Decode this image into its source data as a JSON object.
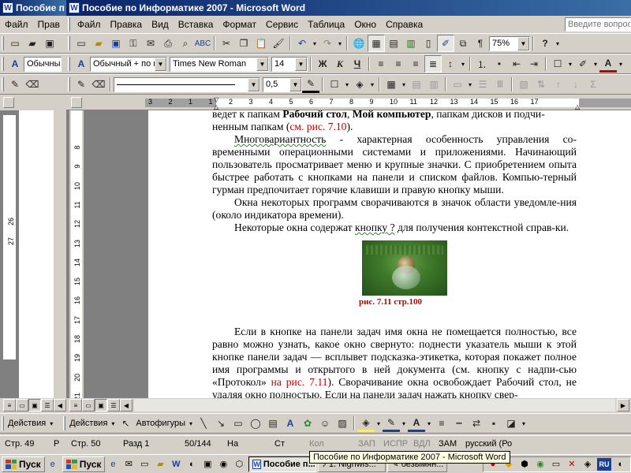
{
  "window": {
    "left_title": "Пособие п",
    "main_title": "Пособие по Информатике 2007  - Microsoft Word",
    "word_icon": "W"
  },
  "menu": {
    "left_items": [
      "Файл",
      "Прав"
    ],
    "items": [
      "Файл",
      "Правка",
      "Вид",
      "Вставка",
      "Формат",
      "Сервис",
      "Таблица",
      "Окно",
      "Справка"
    ],
    "help_placeholder": "Введите вопрос"
  },
  "formatting": {
    "style_left": "Обычный",
    "style": "Обычный + по ц",
    "font": "Times New Roman",
    "size": "14",
    "bold": "Ж",
    "italic": "К",
    "underline": "Ч"
  },
  "standard": {
    "zoom": "75%"
  },
  "drawing_tb": {
    "line_width": "0,5"
  },
  "ruler": {
    "h_labels": [
      "3",
      "2",
      "1",
      "1",
      "2",
      "3",
      "4",
      "5",
      "6",
      "7",
      "8",
      "9",
      "10",
      "11",
      "12",
      "13",
      "14",
      "15",
      "16",
      "17"
    ],
    "left_v_labels": [
      "26",
      "27"
    ],
    "v_labels": [
      "8",
      "9",
      "10",
      "11",
      "12",
      "13",
      "14",
      "15",
      "16",
      "17",
      "18",
      "19",
      "20",
      "21"
    ]
  },
  "document": {
    "line0a": "ведет к папкам ",
    "line0b": "Рабочий стол",
    "line0c": ", ",
    "line0d": "Мой компьютер",
    "line0e": ", папкам дисков и подчи-",
    "line1a": "ненным папкам (",
    "line1ref": "см. рис. 7.10",
    "line1b": ").",
    "p2_word": "Многовариантность",
    "p2_rest": " - характерная особенность управления со-временными операционными системами и приложениями. Начинающий пользователь просматривает меню и крупные значки. С приобретением опыта быстрее работать с кнопками на панели и списком файлов. Компью-терный гурман предпочитает горячие клавиши и правую кнопку мыши.",
    "p3": "Окна некоторых программ сворачиваются в значок области уведомле-ния (около индикатора времени).",
    "p4a": "Некоторые окна содержат ",
    "p4word": "кнопку ?",
    "p4b": " для получения контекстной справ-ки.",
    "caption": "рис. 7.11 стр.100",
    "p5a": "Если в кнопке на панели задач имя окна не помещается полностью, все равно можно узнать, какое окно свернуто: поднести указатель мыши к этой кнопке панели задач — всплывет подсказка-этикетка, которая покажет полное имя программы и открытого в ней документа (см. кнопку с надпи-сью «Протокол» ",
    "p5ref": "на рис. 7.11",
    "p5b": "). Сворачивание окна освобождает Рабочий стол, не удаляя окно полностью. Если на панели задач нажать кнопку свер-"
  },
  "drawing": {
    "actions_left": "Действия",
    "actions": "Действия",
    "autoshapes": "Автофигуры"
  },
  "status": {
    "left_page": "Стр.  49",
    "left_r": "Р",
    "page": "Стр.  50",
    "section": "Разд  1",
    "pages": "50/144",
    "at": "На",
    "line": "Ст",
    "col": "Кол",
    "rec": "ЗАП",
    "trk": "ИСПР",
    "ext": "ВДЛ",
    "ovr": "ЗАМ",
    "lang": "русский (Ро"
  },
  "taskbar": {
    "start": "Пуск",
    "start2": "Пуск",
    "btn1": "Пособие п...",
    "btn2": "1. Nighwis...",
    "btn3": "безымян...",
    "tooltip": "Пособие по Информатике 2007  - Microsoft Word",
    "lang": "RU"
  }
}
